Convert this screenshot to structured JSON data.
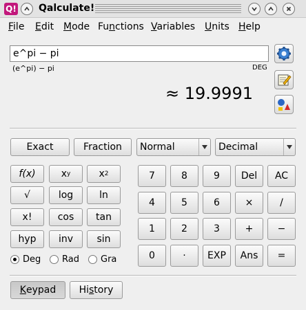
{
  "window": {
    "title": "Qalculate!",
    "icon_text": "Q!"
  },
  "menu": [
    {
      "label": "File",
      "u": "F",
      "rest": "ile"
    },
    {
      "label": "Edit",
      "u": "E",
      "rest": "dit"
    },
    {
      "label": "Mode",
      "u": "M",
      "rest": "ode"
    },
    {
      "label": "Functions",
      "pre": "Fu",
      "u": "n",
      "rest": "ctions"
    },
    {
      "label": "Variables",
      "u": "V",
      "rest": "ariables"
    },
    {
      "label": "Units",
      "u": "U",
      "rest": "nits"
    },
    {
      "label": "Help",
      "u": "H",
      "rest": "elp"
    }
  ],
  "expression": {
    "value": "e^pi − pi",
    "parsed": "(e^pi) − pi",
    "angle_unit": "DEG"
  },
  "result": {
    "text": "≈ 19.9991"
  },
  "mode_row": {
    "exact": "Exact",
    "fraction": "Fraction",
    "display_mode": "Normal",
    "number_base": "Decimal"
  },
  "function_keys": {
    "fx": "f(x)",
    "xy_base": "x",
    "xy_exp": "y",
    "x2_base": "x",
    "x2_exp": "2",
    "sqrt": "√",
    "log": "log",
    "ln": "ln",
    "fact": "x!",
    "cos": "cos",
    "tan": "tan",
    "hyp": "hyp",
    "inv": "inv",
    "sin": "sin"
  },
  "angle": {
    "deg": "Deg",
    "rad": "Rad",
    "gra": "Gra",
    "selected": "Deg"
  },
  "keypad": {
    "k7": "7",
    "k8": "8",
    "k9": "9",
    "del": "Del",
    "ac": "AC",
    "k4": "4",
    "k5": "5",
    "k6": "6",
    "mul": "×",
    "div": "/",
    "k1": "1",
    "k2": "2",
    "k3": "3",
    "add": "+",
    "sub": "−",
    "k0": "0",
    "dot": "·",
    "exp": "EXP",
    "ans": "Ans",
    "eq": "="
  },
  "bottom": {
    "keypad_u": "K",
    "keypad_rest": "eypad",
    "history_pre": "Hi",
    "history_u": "s",
    "history_rest": "tory"
  },
  "colors": {
    "app_icon": "#c2187c"
  }
}
